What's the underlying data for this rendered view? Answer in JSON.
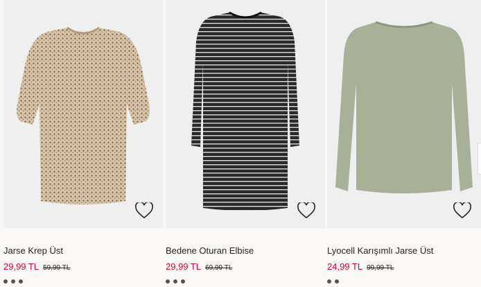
{
  "products": [
    {
      "name": "Jarse Krep Üst",
      "price": "29,99 TL",
      "old_price": "59,99 TL",
      "favorite_icon": "heart-outline-icon"
    },
    {
      "name": "Bedene Oturan Elbise",
      "price": "29,99 TL",
      "old_price": "69,99 TL",
      "favorite_icon": "heart-outline-icon"
    },
    {
      "name": "Lyocell Karışımlı Jarse Üst",
      "price": "24,99 TL",
      "old_price": "99,99 TL",
      "favorite_icon": "heart-outline-icon"
    }
  ],
  "colors": {
    "sale_price": "#d5002b",
    "text": "#222222",
    "background": "#faf9f8"
  }
}
